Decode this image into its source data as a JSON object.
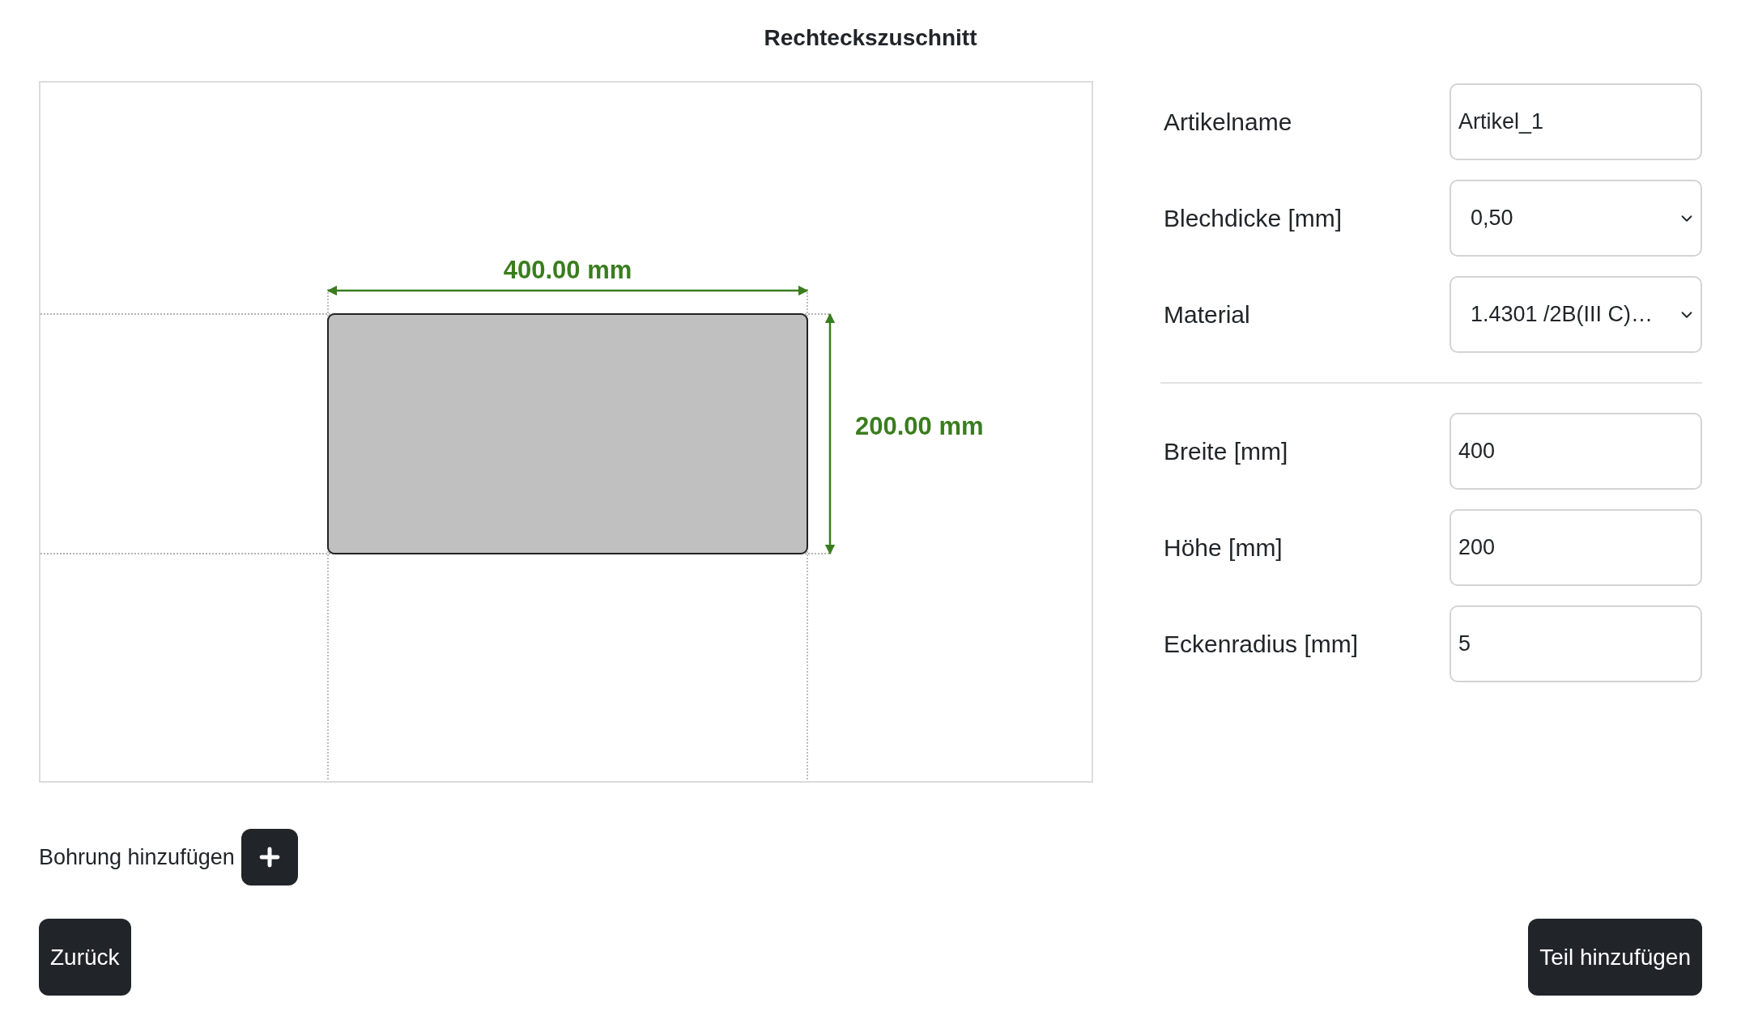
{
  "title": "Rechteckszuschnitt",
  "preview": {
    "width_label": "400.00 mm",
    "height_label": "200.00 mm"
  },
  "fields_top": [
    {
      "kind": "text",
      "label": "Artikelname",
      "value": "Artikel_1"
    },
    {
      "kind": "select",
      "label": "Blechdicke [mm]",
      "value": "0,50"
    },
    {
      "kind": "select",
      "label": "Material",
      "value": "1.4301 /2B(III C)…"
    }
  ],
  "fields_bottom": [
    {
      "kind": "text",
      "label": "Breite [mm]",
      "value": "400"
    },
    {
      "kind": "text",
      "label": "Höhe [mm]",
      "value": "200"
    },
    {
      "kind": "text",
      "label": "Eckenradius [mm]",
      "value": "5"
    }
  ],
  "add_hole": {
    "label": "Bohrung hinzufügen"
  },
  "buttons": {
    "back": "Zurück",
    "add_part": "Teil hinzufügen"
  }
}
